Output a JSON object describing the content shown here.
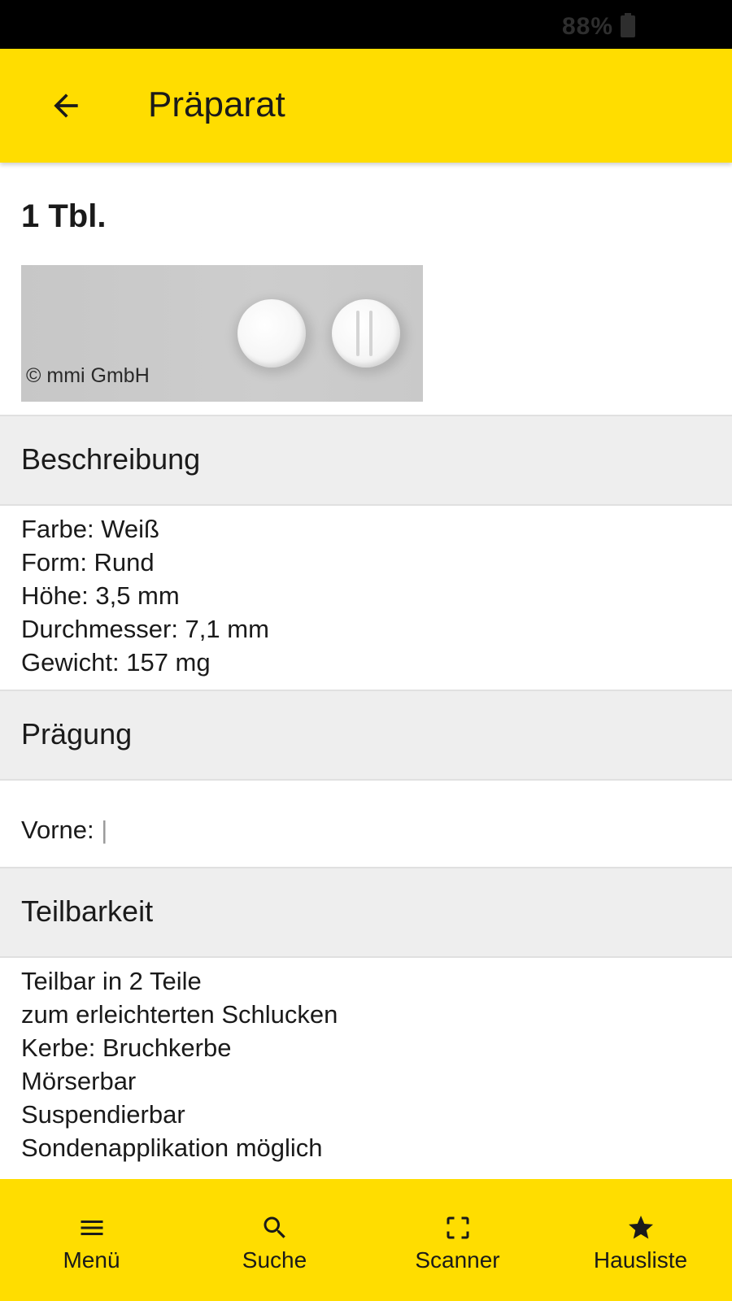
{
  "status_bar": {
    "battery_text": "88%"
  },
  "app_bar": {
    "title": "Präparat"
  },
  "product": {
    "dose": "1 Tbl.",
    "image_copyright": "© mmi GmbH"
  },
  "sections": {
    "beschreibung": {
      "title": "Beschreibung",
      "lines": [
        "Farbe: Weiß",
        "Form: Rund",
        "Höhe: 3,5 mm",
        "Durchmesser: 7,1 mm",
        "Gewicht: 157 mg"
      ]
    },
    "praegung": {
      "title": "Prägung",
      "label": "Vorne: ",
      "value": "|"
    },
    "teilbarkeit": {
      "title": "Teilbarkeit",
      "lines": [
        "Teilbar in 2 Teile",
        "zum erleichterten Schlucken",
        "Kerbe: Bruchkerbe",
        "Mörserbar",
        "Suspendierbar",
        "Sondenapplikation möglich"
      ]
    }
  },
  "bottom_nav": [
    {
      "label": "Menü",
      "icon": "menu-icon"
    },
    {
      "label": "Suche",
      "icon": "search-icon"
    },
    {
      "label": "Scanner",
      "icon": "scanner-icon"
    },
    {
      "label": "Hausliste",
      "icon": "star-icon"
    }
  ],
  "colors": {
    "accent": "#FFDD00",
    "section_bg": "#EEEEEE",
    "text": "#1A1A1A"
  }
}
